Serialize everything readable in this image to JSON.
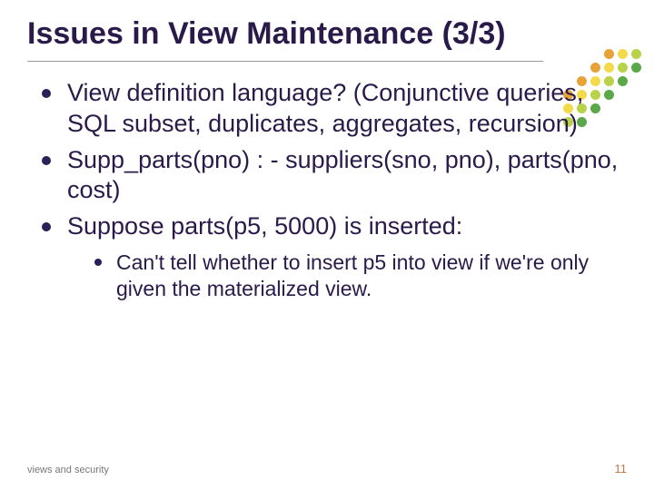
{
  "title": "Issues in View Maintenance (3/3)",
  "bullets": [
    "View definition language? (Conjunctive queries, SQL subset, duplicates, aggregates, recursion)",
    "Supp_parts(pno) : - suppliers(sno, pno), parts(pno, cost)",
    "Suppose parts(p5, 5000) is inserted:"
  ],
  "sub_bullets": [
    "Can't tell whether to insert p5 into view if we're only given the materialized view."
  ],
  "footer": {
    "left": "views and security",
    "right": "11"
  },
  "decor": {
    "grid_colors": [
      [
        "em",
        "em",
        "em",
        "or",
        "ye",
        "li"
      ],
      [
        "em",
        "em",
        "or",
        "ye",
        "li",
        "gr"
      ],
      [
        "em",
        "or",
        "ye",
        "li",
        "gr",
        "em"
      ],
      [
        "or",
        "ye",
        "li",
        "gr",
        "em",
        "em"
      ],
      [
        "ye",
        "li",
        "gr",
        "em",
        "em",
        "em"
      ],
      [
        "li",
        "gr",
        "em",
        "em",
        "em",
        "em"
      ]
    ]
  }
}
